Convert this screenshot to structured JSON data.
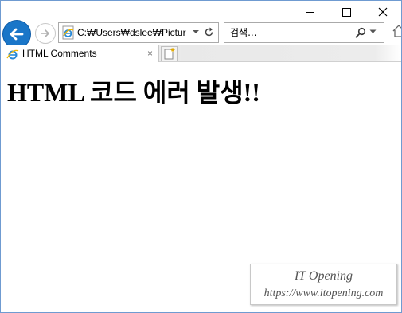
{
  "addressbar": {
    "url": "C:₩Users₩dslee₩Pictures₩"
  },
  "search": {
    "placeholder": "검색..."
  },
  "tab": {
    "title": "HTML Comments",
    "close_glyph": "×"
  },
  "content": {
    "heading": "HTML 코드 에러 발생!!"
  },
  "watermark": {
    "name": "IT Opening",
    "url": "https://www.itopening.com"
  },
  "icons": {
    "back": "back-arrow-icon",
    "forward": "forward-arrow-icon",
    "ie": "ie-logo-icon",
    "refresh": "refresh-icon",
    "search": "search-icon",
    "home": "home-icon",
    "new_tab": "new-tab-icon"
  },
  "colors": {
    "back_button": "#1a76c8",
    "ie_logo": "#2a8ad8",
    "window_border": "#6f9bd1"
  }
}
